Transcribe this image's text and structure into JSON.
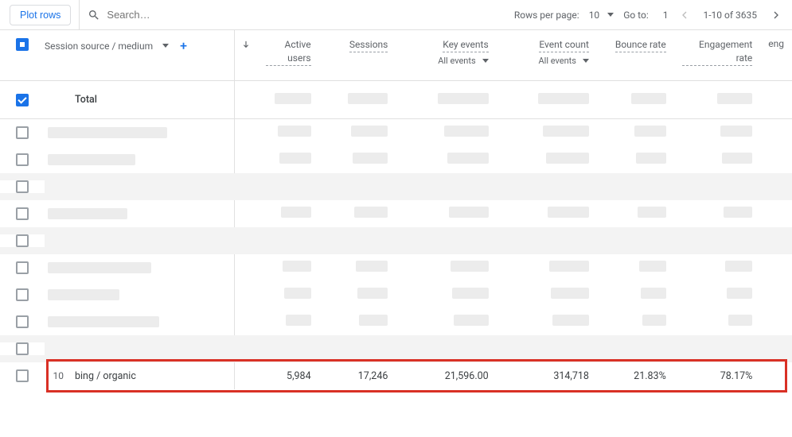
{
  "toolbar": {
    "plot_label": "Plot rows",
    "search_placeholder": "Search…",
    "rows_per_page_label": "Rows per page:",
    "rows_per_page_value": "10",
    "goto_label": "Go to:",
    "goto_value": "1",
    "range_text": "1-10 of 3635"
  },
  "header": {
    "dimension_label": "Session source / medium",
    "metrics": {
      "active_users": "Active users",
      "sessions": "Sessions",
      "key_events": "Key events",
      "key_events_sub": "All events",
      "event_count": "Event count",
      "event_count_sub": "All events",
      "bounce_rate": "Bounce rate",
      "engagement_rate": "Engagement rate",
      "truncated": "eng"
    }
  },
  "total_label": "Total",
  "visible_row": {
    "index": "10",
    "name": "bing / organic",
    "active_users": "5,984",
    "sessions": "17,246",
    "key_events": "21,596.00",
    "event_count": "314,718",
    "bounce_rate": "21.83%",
    "engagement_rate": "78.17%"
  }
}
